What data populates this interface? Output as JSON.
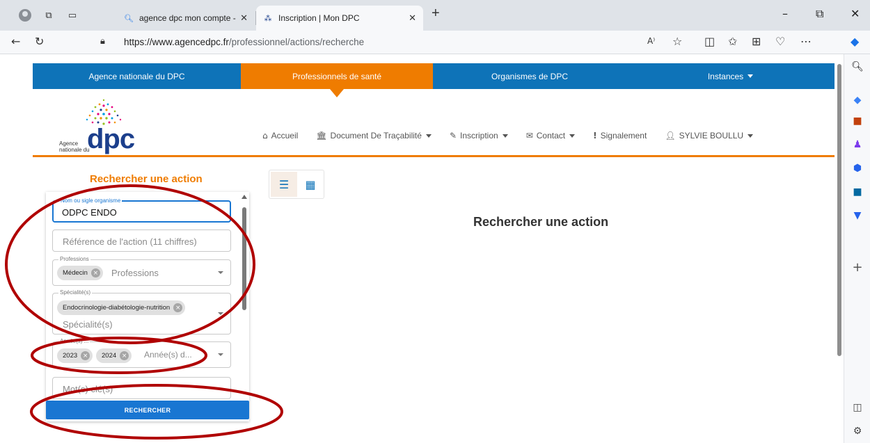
{
  "browser": {
    "tabs": [
      {
        "title": "agence dpc mon compte - Reche",
        "favicon": "search-icon"
      },
      {
        "title": "Inscription | Mon DPC",
        "favicon": "dpc-favicon"
      }
    ],
    "url_host": "https://www.agencedpc.fr",
    "url_path": "/professionnel/actions/recherche"
  },
  "topnav": [
    {
      "label": "Agence nationale du DPC"
    },
    {
      "label": "Professionnels de santé"
    },
    {
      "label": "Organismes de DPC"
    },
    {
      "label": "Instances"
    }
  ],
  "logo": {
    "line1": "Agence",
    "line2": "nationale du",
    "mark": "dpc"
  },
  "menu": {
    "home": "Accueil",
    "tracabilite": "Document De Traçabilité",
    "inscription": "Inscription",
    "contact": "Contact",
    "signalement": "Signalement",
    "user": "SYLVIE BOULLU"
  },
  "search": {
    "title": "Rechercher une action",
    "main_title": "Rechercher une action",
    "org_label": "Nom ou sigle organisme",
    "org_value": "ODPC ENDO",
    "ref_placeholder": "Référence de l'action (11 chiffres)",
    "professions_label": "Professions",
    "professions_chip": "Médecin",
    "professions_placeholder": "Professions",
    "specialite_label": "Spécialité(s)",
    "specialite_chip": "Endocrinologie-diabétologie-nutrition",
    "specialite_placeholder": "Spécialité(s)",
    "annees_label": "Année(s) ...",
    "annees_chips": [
      "2023",
      "2024"
    ],
    "annees_placeholder": "Année(s) d...",
    "motscles_placeholder": "Mot(s) clé(s)",
    "button": "RECHERCHER"
  },
  "colors": {
    "blue": "#0e73b8",
    "orange": "#ef7c00",
    "annotation": "#b00000",
    "button": "#1976d2"
  }
}
